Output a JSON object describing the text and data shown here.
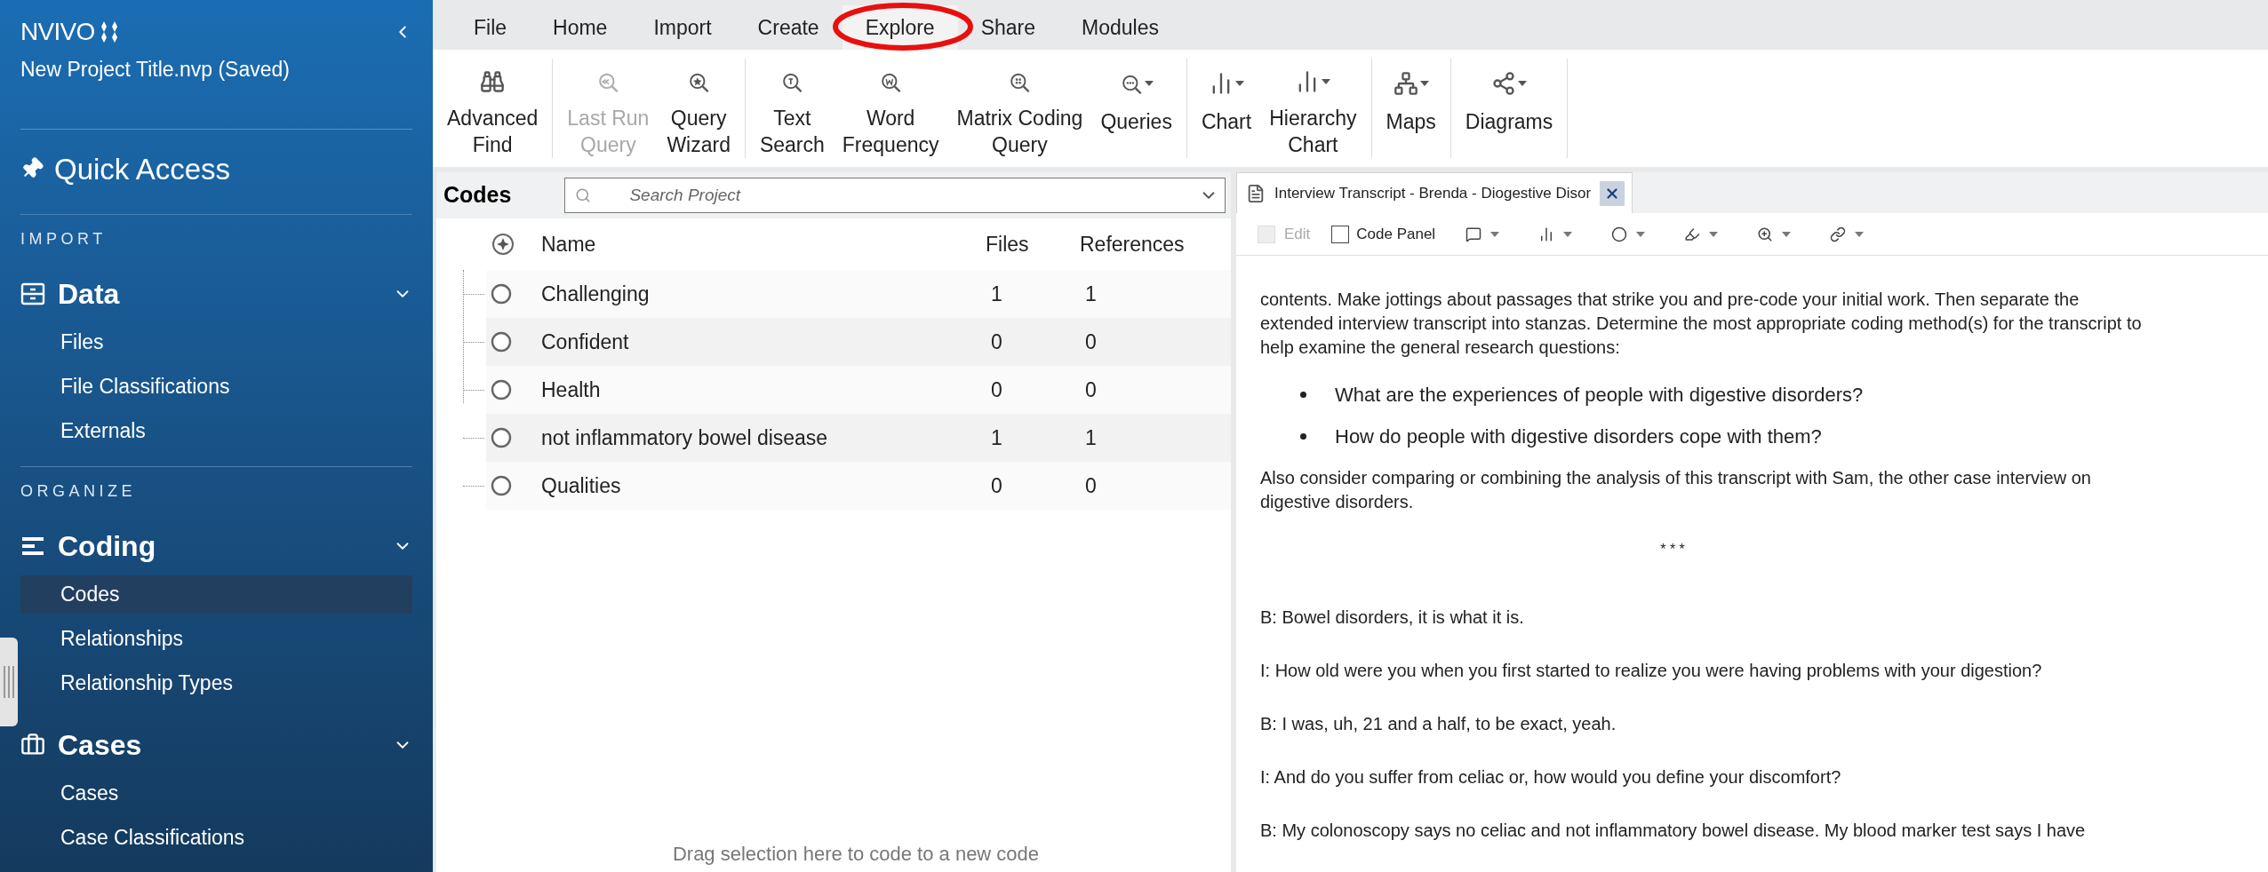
{
  "sidebar": {
    "logo": "NVIVO",
    "project": "New Project Title.nvp (Saved)",
    "quick_access": "Quick Access",
    "sections": [
      {
        "heading": "IMPORT",
        "groups": [
          {
            "title": "Data",
            "kind": "data",
            "expanded": true,
            "items": [
              {
                "label": "Files",
                "selected": false
              },
              {
                "label": "File Classifications",
                "selected": false
              },
              {
                "label": "Externals",
                "selected": false
              }
            ]
          }
        ]
      },
      {
        "heading": "ORGANIZE",
        "groups": [
          {
            "title": "Coding",
            "kind": "coding",
            "expanded": true,
            "items": [
              {
                "label": "Codes",
                "selected": true
              },
              {
                "label": "Relationships",
                "selected": false
              },
              {
                "label": "Relationship Types",
                "selected": false
              }
            ]
          },
          {
            "title": "Cases",
            "kind": "cases",
            "expanded": true,
            "items": [
              {
                "label": "Cases",
                "selected": false
              },
              {
                "label": "Case Classifications",
                "selected": false
              }
            ]
          }
        ]
      }
    ]
  },
  "menu": [
    {
      "label": "File",
      "selected": false,
      "circled": false
    },
    {
      "label": "Home",
      "selected": false,
      "circled": false
    },
    {
      "label": "Import",
      "selected": false,
      "circled": false
    },
    {
      "label": "Create",
      "selected": false,
      "circled": false
    },
    {
      "label": "Explore",
      "selected": true,
      "circled": true
    },
    {
      "label": "Share",
      "selected": false,
      "circled": false
    },
    {
      "label": "Modules",
      "selected": false,
      "circled": false
    }
  ],
  "ribbon": [
    [
      {
        "kind": "find",
        "lines": [
          "Advanced",
          "Find"
        ],
        "disabled": false,
        "dropdown": false
      }
    ],
    [
      {
        "kind": "rerun",
        "lines": [
          "Last Run",
          "Query"
        ],
        "disabled": true,
        "dropdown": false
      },
      {
        "kind": "wizard",
        "lines": [
          "Query",
          "Wizard"
        ],
        "disabled": false,
        "dropdown": false
      }
    ],
    [
      {
        "kind": "text",
        "lines": [
          "Text",
          "Search"
        ],
        "disabled": false,
        "dropdown": false
      },
      {
        "kind": "word",
        "lines": [
          "Word",
          "Frequency"
        ],
        "disabled": false,
        "dropdown": false
      },
      {
        "kind": "matrix",
        "lines": [
          "Matrix Coding",
          "Query"
        ],
        "disabled": false,
        "dropdown": false
      },
      {
        "kind": "queries",
        "lines": [
          "Queries"
        ],
        "disabled": false,
        "dropdown": true
      }
    ],
    [
      {
        "kind": "chart",
        "lines": [
          "Chart"
        ],
        "disabled": false,
        "dropdown": true
      },
      {
        "kind": "chart",
        "lines": [
          "Hierarchy",
          "Chart"
        ],
        "disabled": false,
        "dropdown": true
      }
    ],
    [
      {
        "kind": "maps",
        "lines": [
          "Maps"
        ],
        "disabled": false,
        "dropdown": true
      }
    ],
    [
      {
        "kind": "diagrams",
        "lines": [
          "Diagrams"
        ],
        "disabled": false,
        "dropdown": true
      }
    ]
  ],
  "codes": {
    "title": "Codes",
    "search": {
      "placeholder": "Search Project"
    },
    "columns": [
      "Name",
      "Files",
      "References"
    ],
    "rows": [
      {
        "name": "Challenging",
        "files": "1",
        "references": "1"
      },
      {
        "name": "Confident",
        "files": "0",
        "references": "0"
      },
      {
        "name": "Health",
        "files": "0",
        "references": "0"
      },
      {
        "name": "not inflammatory bowel disease",
        "files": "1",
        "references": "1"
      },
      {
        "name": "Qualities",
        "files": "0",
        "references": "0"
      }
    ],
    "drop_hint": "Drag selection here to code to a new code"
  },
  "document": {
    "tab": "Interview Transcript - Brenda - Diogestive Disor",
    "edit": {
      "label": "Edit",
      "disabled": true
    },
    "code_panel": {
      "label": "Code Panel",
      "checked": false
    },
    "tools": [
      {
        "kind": "comment",
        "dropdown": true
      },
      {
        "kind": "bars",
        "dropdown": true
      },
      {
        "kind": "circle",
        "dropdown": true
      },
      {
        "kind": "pen",
        "dropdown": true
      },
      {
        "kind": "zoom",
        "dropdown": true
      },
      {
        "kind": "link",
        "dropdown": true
      }
    ],
    "body": [
      {
        "kind": "para",
        "text": "contents. Make jottings about passages that strike you and pre-code your initial work. Then separate the extended interview transcript into stanzas. Determine the most appropriate coding method(s) for the transcript to help examine the general research questions:"
      },
      {
        "kind": "bullet",
        "text": "What are the experiences of people with digestive disorders?"
      },
      {
        "kind": "bullet",
        "text": "How do people with digestive disorders cope with them?"
      },
      {
        "kind": "para",
        "text": "Also consider comparing or combining the analysis of this transcript with Sam, the other case interview on digestive disorders."
      },
      {
        "kind": "center",
        "text": "* * *"
      },
      {
        "kind": "line",
        "text": "B: Bowel disorders, it is what it is."
      },
      {
        "kind": "line",
        "text": "I: How old were you when you first started to realize you were having problems with your digestion?"
      },
      {
        "kind": "line",
        "text": "B: I was, uh, 21 and a half, to be exact, yeah."
      },
      {
        "kind": "line",
        "text": "I: And do you suffer from celiac or, how would you define your discomfort?"
      },
      {
        "kind": "line",
        "text": "B: My colonoscopy says no celiac and not inflammatory bowel disease. My blood marker test says I have"
      }
    ]
  }
}
